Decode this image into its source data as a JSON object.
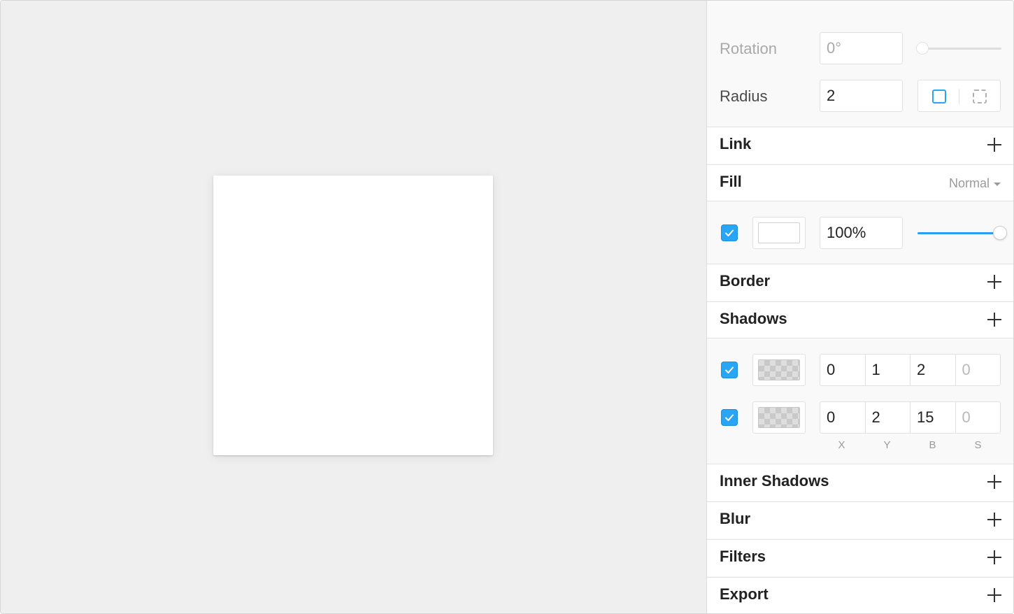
{
  "inspector": {
    "rotation": {
      "label": "Rotation",
      "value": "0°"
    },
    "radius": {
      "label": "Radius",
      "value": "2"
    },
    "link": {
      "title": "Link"
    },
    "fill": {
      "title": "Fill",
      "blend_mode": "Normal",
      "enabled": true,
      "color": "#ffffff",
      "opacity": "100%",
      "opacity_level": 1.0
    },
    "border": {
      "title": "Border"
    },
    "shadows": {
      "title": "Shadows",
      "items": [
        {
          "enabled": true,
          "x": "0",
          "y": "1",
          "b": "2",
          "s": "0"
        },
        {
          "enabled": true,
          "x": "0",
          "y": "2",
          "b": "15",
          "s": "0"
        }
      ],
      "axis_labels": {
        "x": "X",
        "y": "Y",
        "b": "B",
        "s": "S"
      }
    },
    "inner_shadows": {
      "title": "Inner Shadows"
    },
    "blur": {
      "title": "Blur"
    },
    "filters": {
      "title": "Filters"
    },
    "export": {
      "title": "Export"
    }
  },
  "colors": {
    "accent": "#29a5f5",
    "canvas": "#efefef",
    "panel": "#f9f9f9"
  },
  "icons": {
    "checkbox": "checkmark-icon",
    "add": "plus-icon",
    "corner_single": "rounded-square-icon",
    "corner_independent": "dashed-corners-icon"
  }
}
